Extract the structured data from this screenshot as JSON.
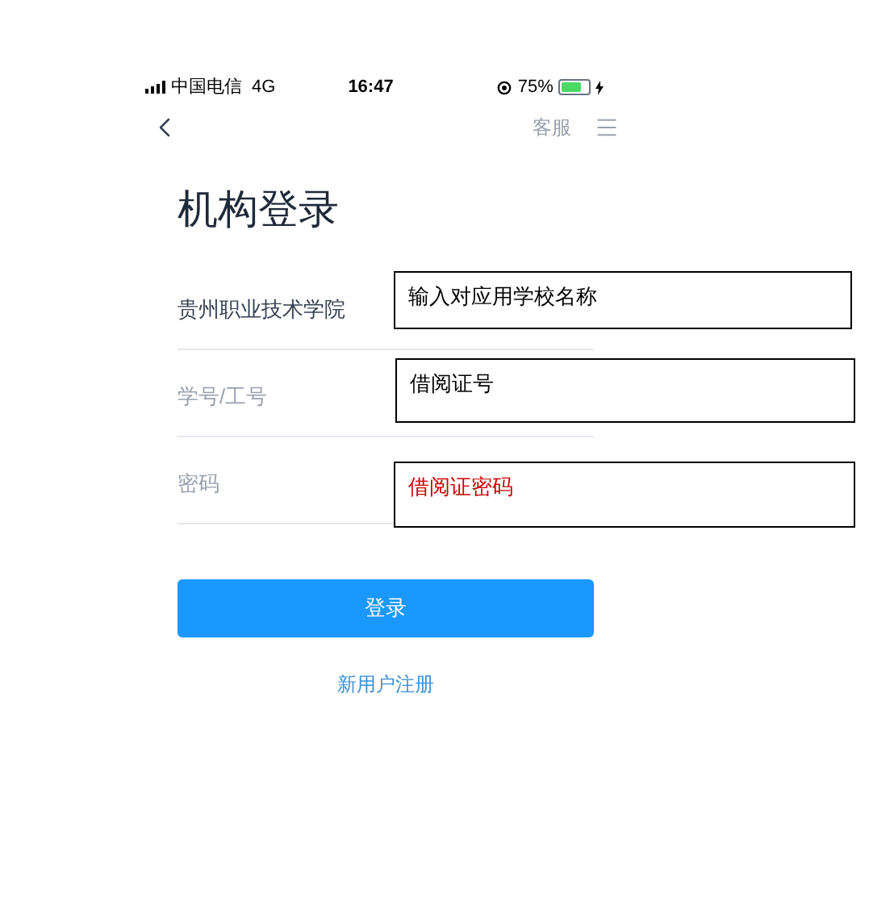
{
  "status_bar": {
    "carrier": "中国电信",
    "network": "4G",
    "time": "16:47",
    "battery": "75%"
  },
  "nav": {
    "service": "客服"
  },
  "title": "机构登录",
  "fields": [
    {
      "value": "贵州职业技术学院"
    },
    {
      "placeholder": "学号/工号"
    },
    {
      "placeholder": "密码"
    }
  ],
  "login_button": "登录",
  "register_link": "新用户注册",
  "annotations": [
    {
      "text": "输入对应用学校名称",
      "color": "#000000"
    },
    {
      "text": "借阅证号",
      "color": "#000000"
    },
    {
      "text": "借阅证密码",
      "color": "#cc0000"
    }
  ]
}
